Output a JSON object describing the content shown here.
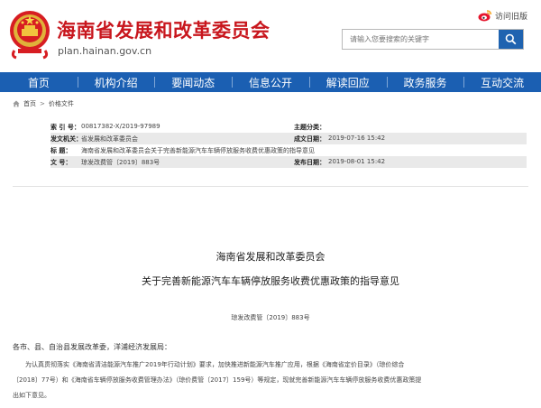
{
  "header": {
    "site_title": "海南省发展和改革委员会",
    "site_url": "plan.hainan.gov.cn",
    "weibo_label": "访问旧版",
    "search_placeholder": "请输入您要搜索的关键字"
  },
  "nav": {
    "items": [
      {
        "label": "首页"
      },
      {
        "label": "机构介绍"
      },
      {
        "label": "要闻动态"
      },
      {
        "label": "信息公开"
      },
      {
        "label": "解读回应"
      },
      {
        "label": "政务服务"
      },
      {
        "label": "互动交流"
      }
    ]
  },
  "breadcrumb": {
    "home": "首页",
    "separator": ">",
    "current": "价格文件"
  },
  "meta": {
    "index_label": "索 引 号：",
    "index_value": "00817382-X/2019-97989",
    "topic_label": "主题分类：",
    "topic_value": "",
    "issuer_label": "发文机关：",
    "issuer_value": "省发展和改革委员会",
    "created_label": "成文日期：",
    "created_value": "2019-07-16 15:42",
    "title_label": "标      题：",
    "title_value": "海南省发展和改革委员会关于完善新能源汽车车辆停放服务收费优惠政策的指导意见",
    "docno_label": "文      号：",
    "docno_value": "琼发改费管〔2019〕883号",
    "published_label": "发布日期：",
    "published_value": "2019-08-01 15:42"
  },
  "document": {
    "org": "海南省发展和改革委员会",
    "title": "关于完善新能源汽车车辆停放服务收费优惠政策的指导意见",
    "number": "琼发改费管〔2019〕883号",
    "addressee": "各市、县、自治县发展改革委，洋浦经济发展局：",
    "body_line1": "为认真贯彻落实《海南省清洁能源汽车推广2019年行动计划》要求，加快推进新能源汽车推广应用，根据《海南省定价目录》（琼价综合",
    "body_line2": "〔2018〕77号）和《海南省车辆停放服务收费管理办法》（琼价费管〔2017〕159号）等规定，现就完善新能源汽车车辆停放服务收费优惠政策提",
    "body_line3": "出如下意见。"
  },
  "colors": {
    "brand_red": "#c8161d",
    "nav_blue": "#1b5fb2",
    "search_blue": "#1f63b0"
  },
  "icons": [
    "national-emblem-icon",
    "weibo-icon",
    "search-icon",
    "home-icon"
  ]
}
